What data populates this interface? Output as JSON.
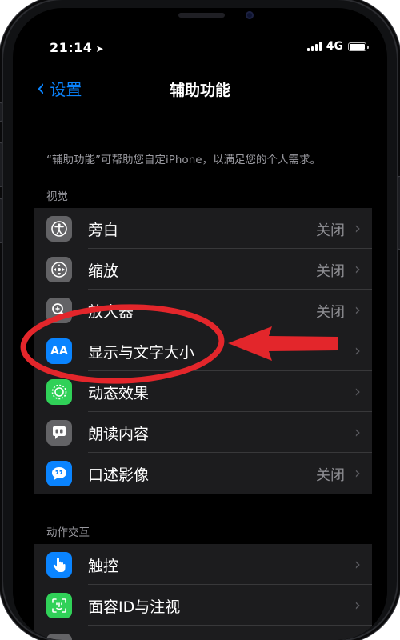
{
  "status_bar": {
    "time": "21:14",
    "network": "4G"
  },
  "nav": {
    "back_label": "设置",
    "title": "辅助功能"
  },
  "description": "“辅助功能”可帮助您自定iPhone，以满足您的个人需求。",
  "sections": [
    {
      "header": "视觉",
      "items": [
        {
          "label": "旁白",
          "value": "关闭",
          "icon": "voiceover-icon"
        },
        {
          "label": "缩放",
          "value": "关闭",
          "icon": "zoom-icon"
        },
        {
          "label": "放大器",
          "value": "关闭",
          "icon": "magnifier-icon"
        },
        {
          "label": "显示与文字大小",
          "value": "",
          "icon": "text-size-icon",
          "icon_text": "AA"
        },
        {
          "label": "动态效果",
          "value": "",
          "icon": "motion-icon"
        },
        {
          "label": "朗读内容",
          "value": "",
          "icon": "spoken-content-icon"
        },
        {
          "label": "口述影像",
          "value": "关闭",
          "icon": "audio-description-icon"
        }
      ]
    },
    {
      "header": "动作交互",
      "items": [
        {
          "label": "触控",
          "value": "",
          "icon": "touch-icon"
        },
        {
          "label": "面容ID与注视",
          "value": "",
          "icon": "face-id-icon"
        }
      ]
    }
  ],
  "colors": {
    "accent": "#0a84ff",
    "annotation": "#e3262b",
    "background": "#000000",
    "cell": "#1c1c1e"
  }
}
